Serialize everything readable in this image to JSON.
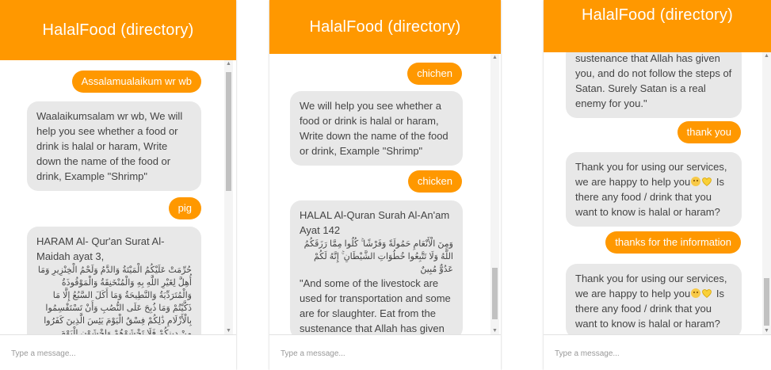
{
  "app": {
    "title": "HalalFood (directory)"
  },
  "input": {
    "placeholder": "Type a message..."
  },
  "colors": {
    "accent": "#ff9800",
    "bot_bubble": "#e8e8e8",
    "bot_text": "#444444"
  },
  "screens": [
    {
      "messages": [
        {
          "from": "user",
          "text": "Assalamualaikum wr wb"
        },
        {
          "from": "bot",
          "text": "Waalaikumsalam wr wb, We will help you see whether a food or drink is halal or haram, Write down the name of the food or drink, Example \"Shrimp\""
        },
        {
          "from": "user",
          "text": "pig"
        },
        {
          "from": "bot",
          "text": "HARAM Al- Qur'an Surat Al- Maidah ayat 3,",
          "arabic": "حُرِّمَتْ عَلَيْكُمُ الْمَيْتَةُ وَالدَّمُ وَلَحْمُ الْخِنْزِيرِ وَمَا أُهِلَّ لِغَيْرِ اللَّهِ بِهِ وَالْمُنْخَنِقَةُ وَالْمَوْقُوذَةُ وَالْمُتَرَدِّيَةُ وَالنَّطِيحَةُ وَمَا أَكَلَ السَّبُعُ إِلَّا مَا ذَكَّيْتُمْ وَمَا ذُبِحَ عَلَى النُّصُبِ وَأَنْ تَسْتَقْسِمُوا بِالْأَزْلَامِ ذَٰلِكُمْ فِسْقٌ الْيَوْمَ يَئِسَ الَّذِينَ كَفَرُوا مِنْ دِينِكُمْ فَلَا تَخْشَوْهُمْ وَاخْشَوْنِ الْيَوْمَ أَكْمَلْتُ لَكُمْ دِينَكُمْ وَأَتْمَمْتُ عَلَيْكُمْ نِعْمَتِي وَرَضِيتُ لَكُمُ"
        }
      ]
    },
    {
      "messages": [
        {
          "from": "user",
          "text": "chichen"
        },
        {
          "from": "bot",
          "text": "We will help you see whether a food or drink is halal or haram, Write down the name of the food or drink, Example \"Shrimp\""
        },
        {
          "from": "user",
          "text": "chicken"
        },
        {
          "from": "bot",
          "text_before": "HALAL Al-Quran Surah Al-An'am Ayat 142",
          "arabic": "وَمِنَ الْأَنْعَامِ حَمُولَةً وَفَرْشًا ۚ كُلُوا مِمَّا رَزَقَكُمُ اللَّهُ وَلَا تَتَّبِعُوا خُطُوَاتِ الشَّيْطَانِ ۚ إِنَّهُ لَكُمْ عَدُوٌّ مُبِينٌ",
          "text_after": "\"And some of the livestock are used for transportation and some are for slaughter. Eat from the sustenance that Allah has given you, and do not follow the steps of Satan. Surely Satan is a real enemy"
        }
      ]
    },
    {
      "messages": [
        {
          "from": "bot",
          "text": "sustenance that Allah has given you, and do not follow the steps of Satan. Surely Satan is a real enemy for you.\""
        },
        {
          "from": "user",
          "text": "thank you"
        },
        {
          "from": "bot",
          "text_a": "Thank you for using our services, we are happy to help you",
          "text_b": " Is there any food / drink that you want to know is halal or haram?"
        },
        {
          "from": "user",
          "text": "thanks for the information"
        },
        {
          "from": "bot",
          "text_a": "Thank you for using our services, we are happy to help you",
          "text_b": " Is there any food / drink that you want to know is halal or haram?"
        }
      ]
    }
  ]
}
